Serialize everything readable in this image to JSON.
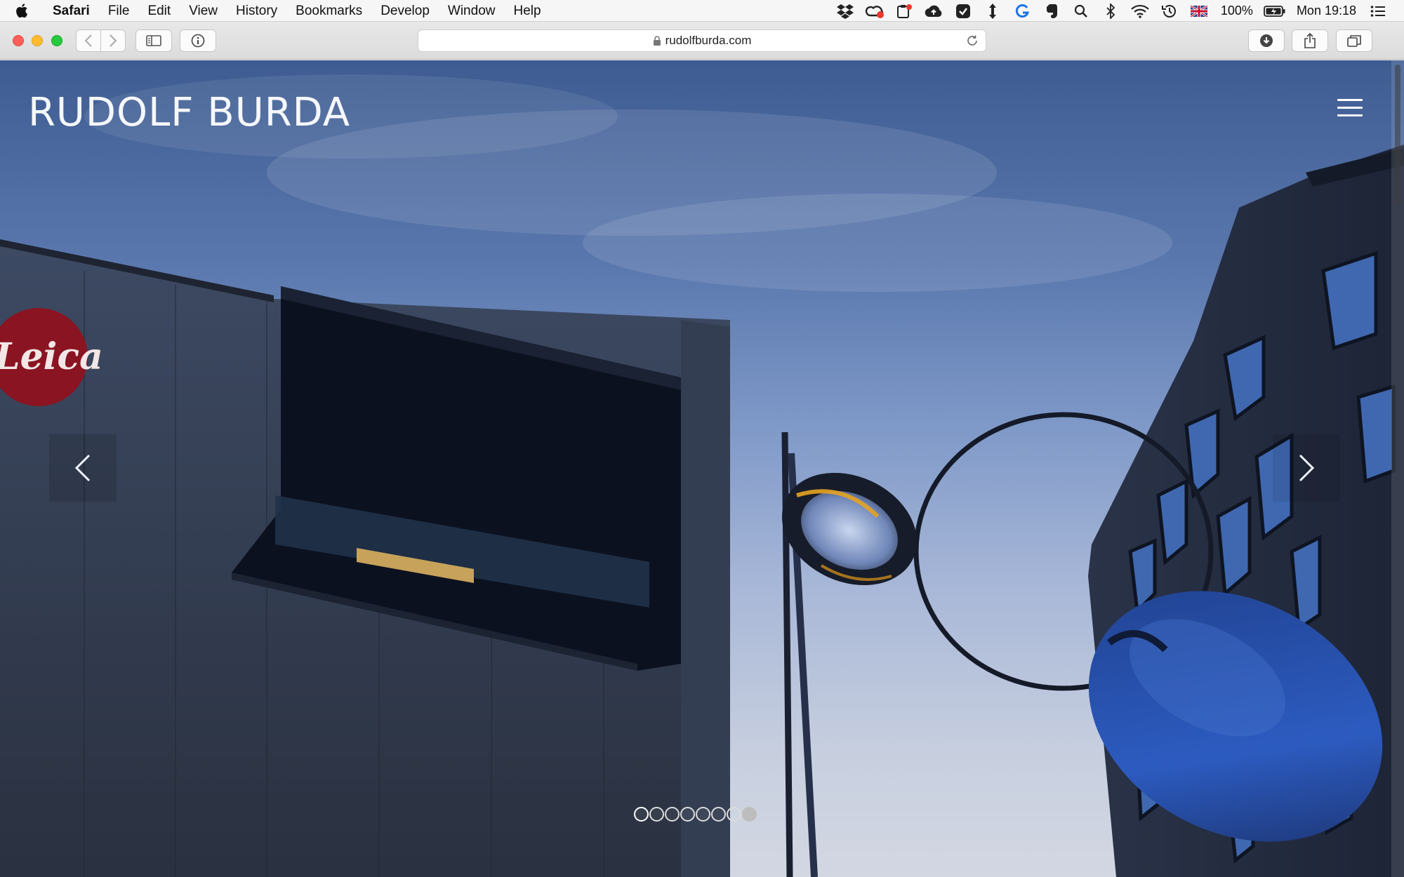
{
  "menubar": {
    "app_name": "Safari",
    "items": [
      "File",
      "Edit",
      "View",
      "History",
      "Bookmarks",
      "Develop",
      "Window",
      "Help"
    ],
    "battery": "100%",
    "clock": "Mon 19:18"
  },
  "browser": {
    "url": "rudolfburda.com"
  },
  "site": {
    "title": "RUDOLF BURDA",
    "sign_text": "Leica",
    "slides": {
      "count": 8,
      "current": 1
    }
  }
}
